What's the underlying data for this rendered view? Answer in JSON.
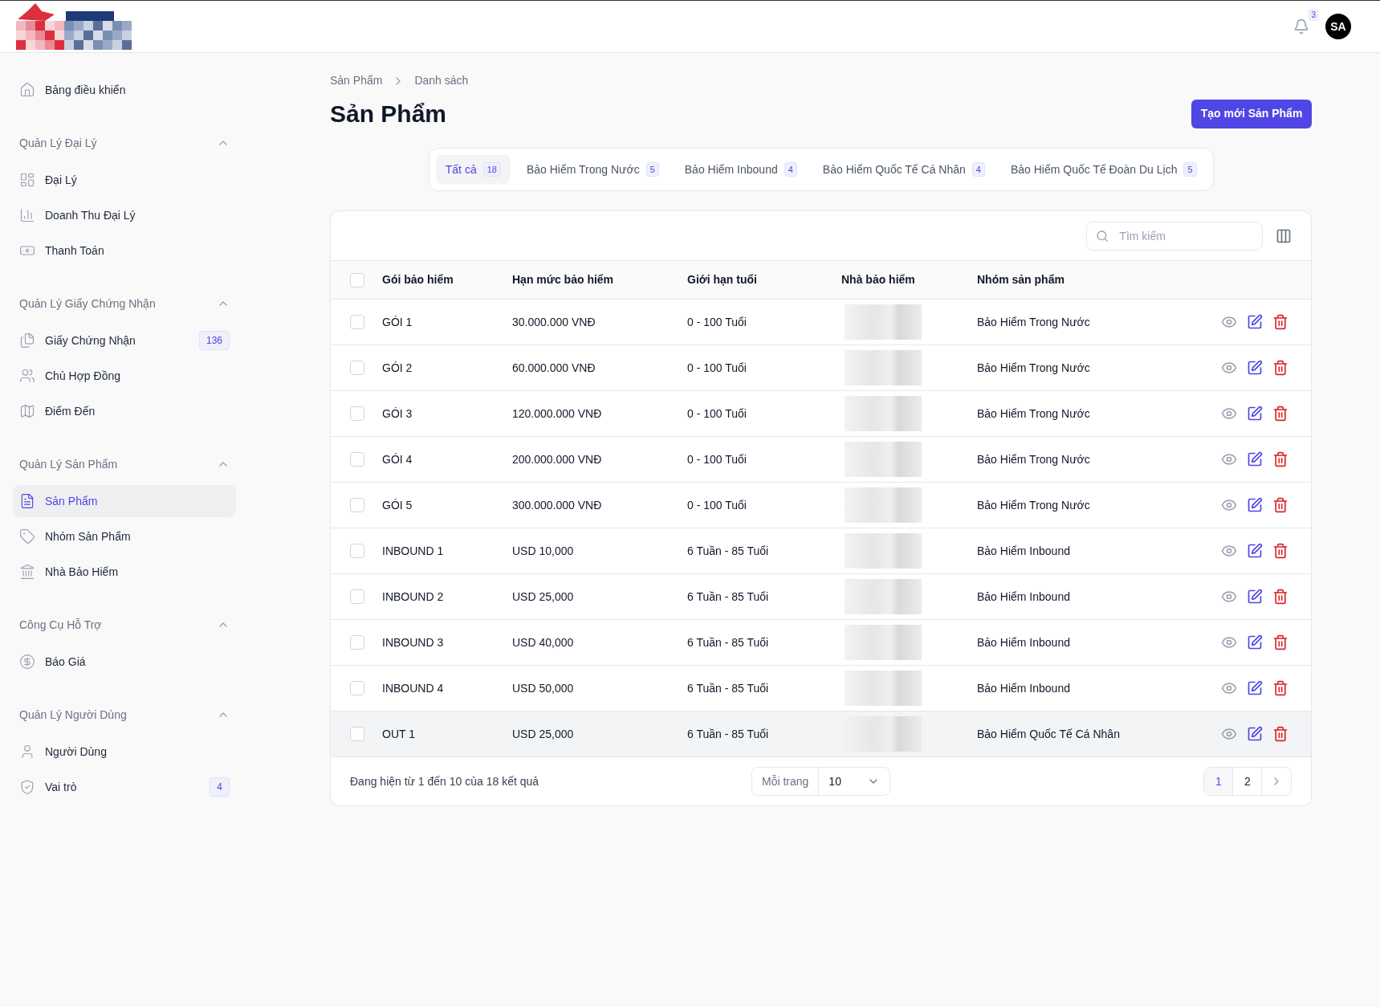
{
  "header": {
    "notification_count": "3",
    "avatar": "SA"
  },
  "sidebar": {
    "items": [
      {
        "kind": "link",
        "label": "Bảng điều khiển",
        "selected": false
      },
      {
        "kind": "section",
        "label": "Quản Lý Đại Lý",
        "expanded": true
      },
      {
        "kind": "link",
        "label": "Đại Lý",
        "selected": false
      },
      {
        "kind": "link",
        "label": "Doanh Thu Đại Lý",
        "selected": false
      },
      {
        "kind": "link",
        "label": "Thanh Toán",
        "selected": false
      },
      {
        "kind": "section",
        "label": "Quản Lý Giấy Chứng Nhận",
        "expanded": true
      },
      {
        "kind": "link",
        "label": "Giấy Chứng Nhận",
        "badge": "136",
        "selected": false
      },
      {
        "kind": "link",
        "label": "Chủ Hợp Đồng",
        "selected": false
      },
      {
        "kind": "link",
        "label": "Điểm Đến",
        "selected": false
      },
      {
        "kind": "section",
        "label": "Quản Lý Sản Phẩm",
        "expanded": true
      },
      {
        "kind": "link",
        "label": "Sản Phẩm",
        "selected": true
      },
      {
        "kind": "link",
        "label": "Nhóm Sản Phẩm",
        "selected": false
      },
      {
        "kind": "link",
        "label": "Nhà Bảo Hiểm",
        "selected": false
      },
      {
        "kind": "section",
        "label": "Công Cụ Hỗ Trợ",
        "expanded": true
      },
      {
        "kind": "link",
        "label": "Báo Giá",
        "selected": false
      },
      {
        "kind": "section",
        "label": "Quản Lý Người Dùng",
        "expanded": true
      },
      {
        "kind": "link",
        "label": "Người Dùng",
        "selected": false
      },
      {
        "kind": "link",
        "label": "Vai trò",
        "badge": "4",
        "selected": false
      }
    ]
  },
  "breadcrumb": [
    "Sản Phẩm",
    "Danh sách"
  ],
  "page_title": "Sản Phẩm",
  "create_button": "Tạo mới Sản Phẩm",
  "tabs": [
    {
      "label": "Tất cả",
      "count": "18",
      "selected": true
    },
    {
      "label": "Bảo Hiểm Trong Nước",
      "count": "5",
      "selected": false
    },
    {
      "label": "Bảo Hiểm Inbound",
      "count": "4",
      "selected": false
    },
    {
      "label": "Bảo Hiểm Quốc Tế Cá Nhân",
      "count": "4",
      "selected": false
    },
    {
      "label": "Bảo Hiểm Quốc Tế Đoàn Du Lịch",
      "count": "5",
      "selected": false
    }
  ],
  "search": {
    "placeholder": "Tìm kiếm"
  },
  "table": {
    "columns": [
      "Gói bảo hiểm",
      "Hạn mức bảo hiểm",
      "Giới hạn tuổi",
      "Nhà bảo hiểm",
      "Nhóm sản phẩm"
    ],
    "select_all_checked": false,
    "rows": [
      {
        "cells": [
          "GÓI 1",
          "30.000.000 VNĐ",
          "0 - 100 Tuổi",
          "Bảo Hiểm Trong Nước"
        ],
        "checked": false,
        "hovered": false
      },
      {
        "cells": [
          "GÓI 2",
          "60.000.000 VNĐ",
          "0 - 100 Tuổi",
          "Bảo Hiểm Trong Nước"
        ],
        "checked": false,
        "hovered": false
      },
      {
        "cells": [
          "GÓI 3",
          "120.000.000 VNĐ",
          "0 - 100 Tuổi",
          "Bảo Hiểm Trong Nước"
        ],
        "checked": false,
        "hovered": false
      },
      {
        "cells": [
          "GÓI 4",
          "200.000.000 VNĐ",
          "0 - 100 Tuổi",
          "Bảo Hiểm Trong Nước"
        ],
        "checked": false,
        "hovered": false
      },
      {
        "cells": [
          "GÓI 5",
          "300.000.000 VNĐ",
          "0 - 100 Tuổi",
          "Bảo Hiểm Trong Nước"
        ],
        "checked": false,
        "hovered": false
      },
      {
        "cells": [
          "INBOUND 1",
          "USD 10,000",
          "6 Tuần - 85 Tuổi",
          "Bảo Hiểm Inbound"
        ],
        "checked": false,
        "hovered": false
      },
      {
        "cells": [
          "INBOUND 2",
          "USD 25,000",
          "6 Tuần - 85 Tuổi",
          "Bảo Hiểm Inbound"
        ],
        "checked": false,
        "hovered": false
      },
      {
        "cells": [
          "INBOUND 3",
          "USD 40,000",
          "6 Tuần - 85 Tuổi",
          "Bảo Hiểm Inbound"
        ],
        "checked": false,
        "hovered": false
      },
      {
        "cells": [
          "INBOUND 4",
          "USD 50,000",
          "6 Tuần - 85 Tuổi",
          "Bảo Hiểm Inbound"
        ],
        "checked": false,
        "hovered": false
      },
      {
        "cells": [
          "OUT 1",
          "USD 25,000",
          "6 Tuần - 85 Tuổi",
          "Bảo Hiểm Quốc Tế Cá Nhân"
        ],
        "checked": false,
        "hovered": true
      }
    ]
  },
  "footer": {
    "summary": "Đang hiện từ 1 đến 10 của 18 kết quả",
    "per_page_label": "Mỗi trang",
    "per_page_value": "10",
    "pages": [
      {
        "label": "1",
        "selected": true
      },
      {
        "label": "2",
        "selected": false
      }
    ]
  }
}
